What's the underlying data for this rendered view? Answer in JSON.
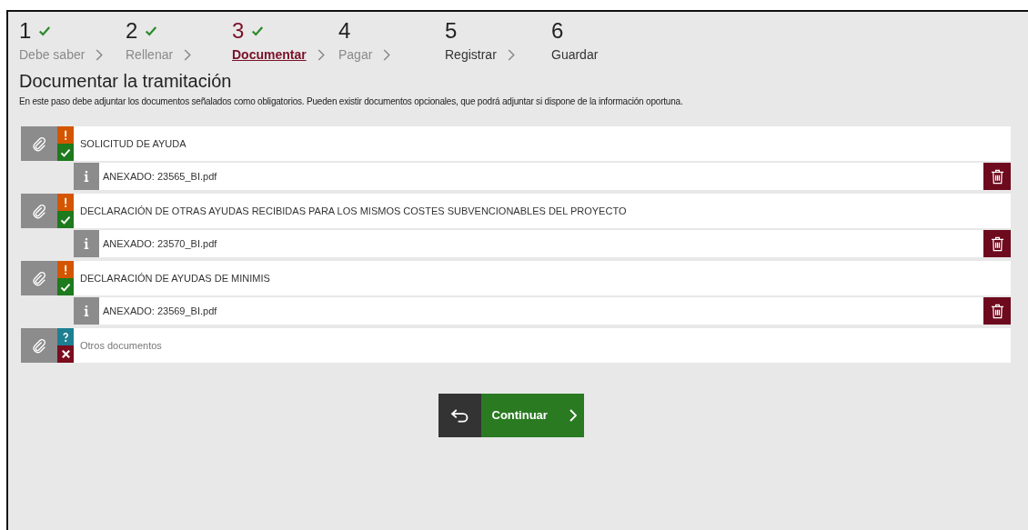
{
  "steps": [
    {
      "number": "1",
      "label": "Debe saber",
      "done": true,
      "selected": false,
      "disabled": true
    },
    {
      "number": "2",
      "label": "Rellenar",
      "done": true,
      "selected": false,
      "disabled": true
    },
    {
      "number": "3",
      "label": "Documentar",
      "done": true,
      "selected": true,
      "disabled": false
    },
    {
      "number": "4",
      "label": "Pagar",
      "done": false,
      "selected": false,
      "disabled": true
    },
    {
      "number": "5",
      "label": "Registrar",
      "done": false,
      "selected": false,
      "disabled": false
    },
    {
      "number": "6",
      "label": "Guardar",
      "done": false,
      "selected": false,
      "disabled": false
    }
  ],
  "heading": "Documentar la tramitación",
  "description": "En este paso debe adjuntar los documentos señalados como obligatorios. Pueden existir documentos opcionales, que podrá adjuntar si dispone de la información oportuna.",
  "documents": [
    {
      "title": "SOLICITUD DE AYUDA",
      "required": true,
      "attached": true,
      "attachment": "ANEXADO: 23565_BI.pdf"
    },
    {
      "title": "DECLARACIÓN DE OTRAS AYUDAS RECIBIDAS PARA LOS MISMOS COSTES SUBVENCIONABLES DEL PROYECTO",
      "required": true,
      "attached": true,
      "attachment": "ANEXADO: 23570_BI.pdf"
    },
    {
      "title": "DECLARACIÓN DE AYUDAS DE MINIMIS",
      "required": true,
      "attached": true,
      "attachment": "ANEXADO: 23569_BI.pdf"
    },
    {
      "title": "Otros documentos",
      "required": false,
      "attached": false
    }
  ],
  "continue_button": "Continuar"
}
